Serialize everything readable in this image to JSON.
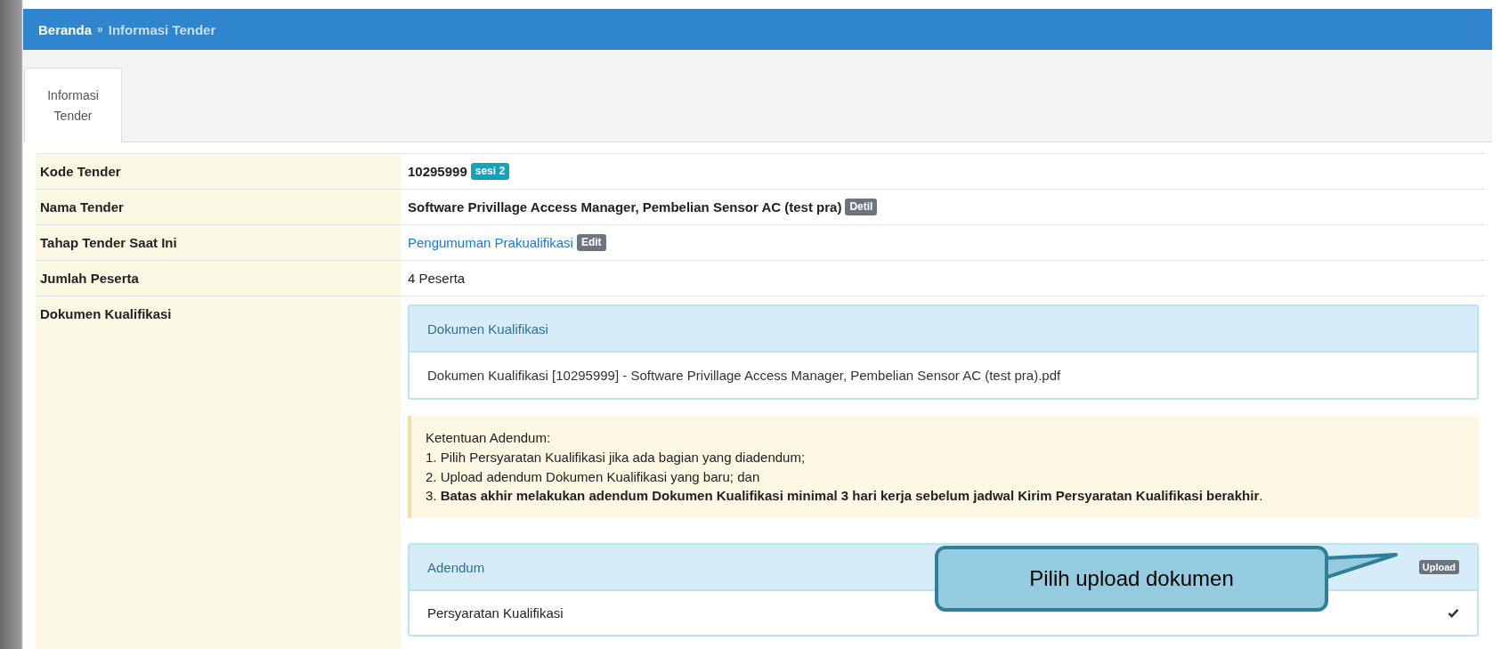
{
  "breadcrumb": [
    {
      "label": "Beranda",
      "current": false
    },
    {
      "label": "Informasi Tender",
      "current": true
    }
  ],
  "breadcrumb_separator": "»",
  "tabs": [
    {
      "label": "Informasi Tender",
      "selected": true
    }
  ],
  "rows": [
    {
      "label": "Kode Tender",
      "kind": "code",
      "value": "10295999",
      "badge": "sesi 2"
    },
    {
      "label": "Nama Tender",
      "kind": "name",
      "value": "Software Privillage Access Manager, Pembelian Sensor AC (test pra)",
      "badge": "Detil"
    },
    {
      "label": "Tahap Tender Saat Ini",
      "kind": "link",
      "value": "Pengumuman Prakualifikasi",
      "badge": "Edit"
    },
    {
      "label": "Jumlah Peserta",
      "kind": "plain",
      "value": "4 Peserta"
    },
    {
      "label": "Dokumen Kualifikasi",
      "kind": "documents"
    }
  ],
  "documents_panel": {
    "title": "Dokumen Kualifikasi",
    "file": "Dokumen Kualifikasi [10295999] - Software Privillage Access Manager, Pembelian Sensor AC (test pra).pdf"
  },
  "notice": {
    "title": "Ketentuan Adendum:",
    "items": [
      "1. Pilih Persyaratan Kualifikasi jika ada bagian yang diadendum;",
      "2. Upload adendum Dokumen Kualifikasi yang baru; dan",
      "3. **Batas akhir melakukan adendum Dokumen Kualifikasi minimal 3 hari kerja sebelum jadwal Kirim Persyaratan Kualifikasi berakhir**."
    ]
  },
  "addendum_panel": {
    "title": "Adendum",
    "button": "Upload",
    "items": [
      {
        "label": "Persyaratan Kualifikasi",
        "checked": true
      }
    ]
  },
  "callout": {
    "text": "Pilih upload dokumen"
  }
}
